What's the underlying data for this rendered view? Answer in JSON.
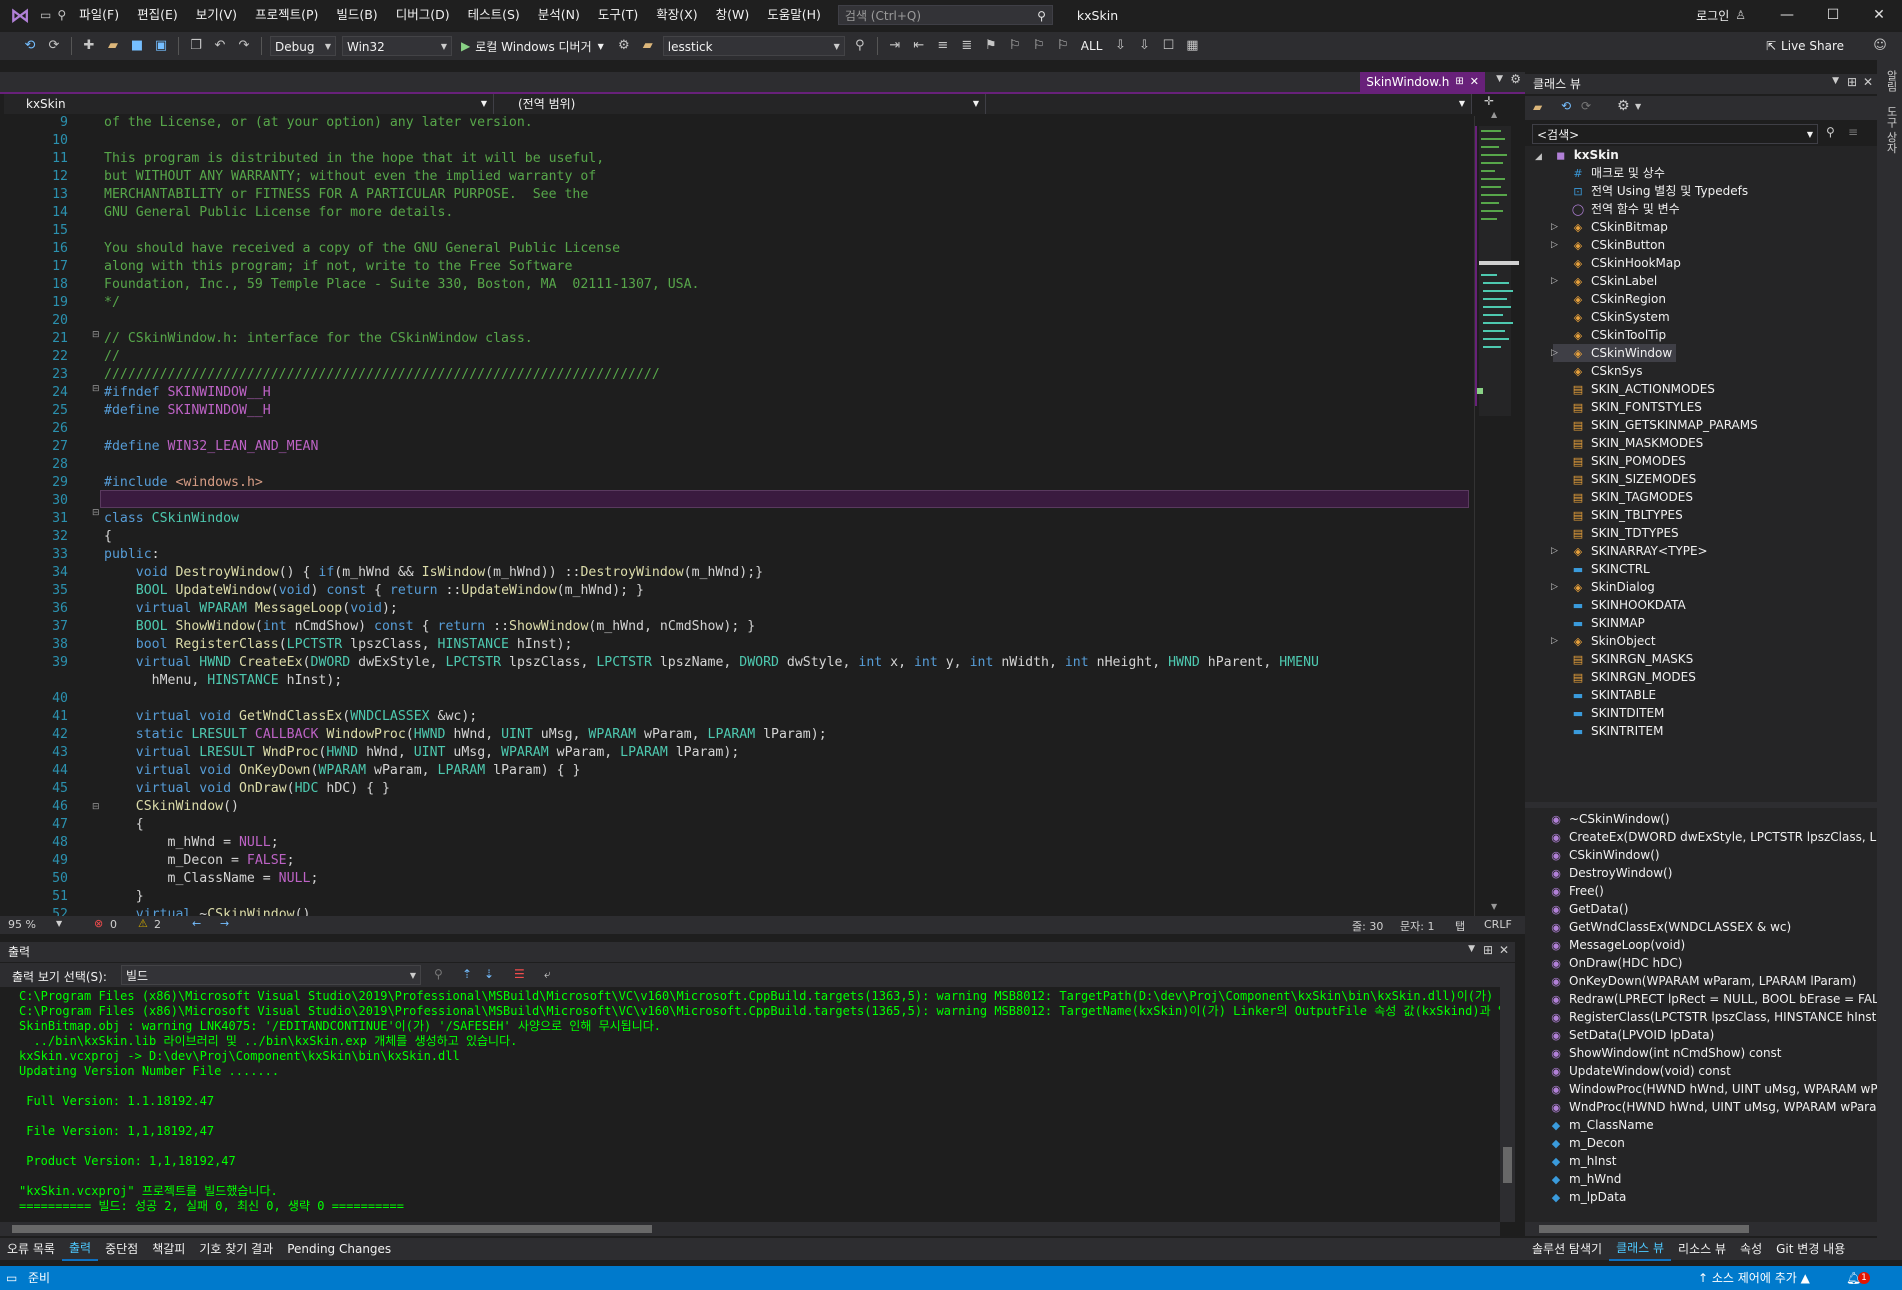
{
  "titlebar": {
    "menus": [
      "파일(F)",
      "편집(E)",
      "보기(V)",
      "프로젝트(P)",
      "빌드(B)",
      "디버그(D)",
      "테스트(S)",
      "분석(N)",
      "도구(T)",
      "확장(X)",
      "창(W)",
      "도움말(H)"
    ],
    "search_placeholder": "검색 (Ctrl+Q)",
    "solution_name": "kxSkin",
    "login": "로그인"
  },
  "toolbar": {
    "config": "Debug",
    "platform": "Win32",
    "run_label": "로컬 Windows 디버거",
    "find_combo": "lesstick",
    "all_label": "ALL",
    "live_share": "Live Share"
  },
  "editor": {
    "tab_title": "SkinWindow.h",
    "nav_project": "kxSkin",
    "nav_scope": "(전역 범위)",
    "zoom": "95 %",
    "errors": "0",
    "warnings": "2",
    "line": "줄: 30",
    "col": "문자: 1",
    "tab_mode": "탭",
    "eol": "CRLF",
    "lines": [
      {
        "n": "9",
        "html": "<span class=\"cm\">of the License, or (at your option) any later version.</span>"
      },
      {
        "n": "10",
        "html": ""
      },
      {
        "n": "11",
        "html": "<span class=\"cm\">This program is distributed in the hope that it will be useful,</span>"
      },
      {
        "n": "12",
        "html": "<span class=\"cm\">but WITHOUT ANY WARRANTY; without even the implied warranty of</span>"
      },
      {
        "n": "13",
        "html": "<span class=\"cm\">MERCHANTABILITY or FITNESS FOR A PARTICULAR PURPOSE.  See the</span>"
      },
      {
        "n": "14",
        "html": "<span class=\"cm\">GNU General Public License for more details.</span>"
      },
      {
        "n": "15",
        "html": ""
      },
      {
        "n": "16",
        "html": "<span class=\"cm\">You should have received a copy of the GNU General Public License</span>"
      },
      {
        "n": "17",
        "html": "<span class=\"cm\">along with this program; if not, write to the Free Software</span>"
      },
      {
        "n": "18",
        "html": "<span class=\"cm\">Foundation, Inc., 59 Temple Place - Suite 330, Boston, MA  02111-1307, USA.</span>"
      },
      {
        "n": "19",
        "html": "<span class=\"cm\">*/</span>"
      },
      {
        "n": "20",
        "html": ""
      },
      {
        "n": "21",
        "html": "<span class=\"cm\">// CSkinWindow.h: interface for the CSkinWindow class.</span>"
      },
      {
        "n": "22",
        "html": "<span class=\"cm\">//</span>"
      },
      {
        "n": "23",
        "html": "<span class=\"cm\">//////////////////////////////////////////////////////////////////////</span>"
      },
      {
        "n": "24",
        "html": "<span class=\"kw\">#ifndef</span> <span class=\"mac\">SKINWINDOW__H</span>"
      },
      {
        "n": "25",
        "html": "<span class=\"kw\">#define</span> <span class=\"mac\">SKINWINDOW__H</span>"
      },
      {
        "n": "26",
        "html": ""
      },
      {
        "n": "27",
        "html": "<span class=\"kw\">#define</span> <span class=\"mac\">WIN32_LEAN_AND_MEAN</span>"
      },
      {
        "n": "28",
        "html": ""
      },
      {
        "n": "29",
        "html": "<span class=\"kw\">#include</span> <span class=\"st\">&lt;windows.h&gt;</span>"
      },
      {
        "n": "30",
        "html": ""
      },
      {
        "n": "31",
        "html": "<span class=\"kw\">class</span> <span class=\"ty\">CSkinWindow</span>"
      },
      {
        "n": "32",
        "html": "{"
      },
      {
        "n": "33",
        "html": "<span class=\"kw\">public</span>:"
      },
      {
        "n": "34",
        "html": "    <span class=\"kw\">void</span> <span class=\"fn\">DestroyWindow</span>() { <span class=\"kw\">if</span>(m_hWnd &amp;&amp; <span class=\"fn\">IsWindow</span>(m_hWnd)) ::<span class=\"fn\">DestroyWindow</span>(m_hWnd);}"
      },
      {
        "n": "35",
        "html": "    <span class=\"ty\">BOOL</span> <span class=\"fn\">UpdateWindow</span>(<span class=\"kw\">void</span>) <span class=\"kw\">const</span> { <span class=\"kw\">return</span> ::<span class=\"fn\">UpdateWindow</span>(m_hWnd); }"
      },
      {
        "n": "36",
        "html": "    <span class=\"kw\">virtual</span> <span class=\"ty\">WPARAM</span> <span class=\"fn\">MessageLoop</span>(<span class=\"kw\">void</span>);"
      },
      {
        "n": "37",
        "html": "    <span class=\"ty\">BOOL</span> <span class=\"fn\">ShowWindow</span>(<span class=\"kw\">int</span> nCmdShow) <span class=\"kw\">const</span> { <span class=\"kw\">return</span> ::<span class=\"fn\">ShowWindow</span>(m_hWnd, nCmdShow); }"
      },
      {
        "n": "38",
        "html": "    <span class=\"kw\">bool</span> <span class=\"fn\">RegisterClass</span>(<span class=\"ty\">LPCTSTR</span> lpszClass, <span class=\"ty\">HINSTANCE</span> hInst);"
      },
      {
        "n": "39",
        "html": "    <span class=\"kw\">virtual</span> <span class=\"ty\">HWND</span> <span class=\"fn\">CreateEx</span>(<span class=\"ty\">DWORD</span> dwExStyle, <span class=\"ty\">LPCTSTR</span> lpszClass, <span class=\"ty\">LPCTSTR</span> lpszName, <span class=\"ty\">DWORD</span> dwStyle, <span class=\"kw\">int</span> x, <span class=\"kw\">int</span> y, <span class=\"kw\">int</span> nWidth, <span class=\"kw\">int</span> nHeight, <span class=\"ty\">HWND</span> hParent, <span class=\"ty\">HMENU</span>"
      },
      {
        "n": "",
        "html": "      hMenu, <span class=\"ty\">HINSTANCE</span> hInst);"
      },
      {
        "n": "40",
        "html": ""
      },
      {
        "n": "41",
        "html": "    <span class=\"kw\">virtual</span> <span class=\"kw\">void</span> <span class=\"fn\">GetWndClassEx</span>(<span class=\"ty\">WNDCLASSEX</span> &amp;wc);"
      },
      {
        "n": "42",
        "html": "    <span class=\"kw\">static</span> <span class=\"ty\">LRESULT</span> <span class=\"mac\">CALLBACK</span> <span class=\"fn\">WindowProc</span>(<span class=\"ty\">HWND</span> hWnd, <span class=\"ty\">UINT</span> uMsg, <span class=\"ty\">WPARAM</span> wParam, <span class=\"ty\">LPARAM</span> lParam);"
      },
      {
        "n": "43",
        "html": "    <span class=\"kw\">virtual</span> <span class=\"ty\">LRESULT</span> <span class=\"fn\">WndProc</span>(<span class=\"ty\">HWND</span> hWnd, <span class=\"ty\">UINT</span> uMsg, <span class=\"ty\">WPARAM</span> wParam, <span class=\"ty\">LPARAM</span> lParam);"
      },
      {
        "n": "44",
        "html": "    <span class=\"kw\">virtual</span> <span class=\"kw\">void</span> <span class=\"fn\">OnKeyDown</span>(<span class=\"ty\">WPARAM</span> wParam, <span class=\"ty\">LPARAM</span> lParam) { }"
      },
      {
        "n": "45",
        "html": "    <span class=\"kw\">virtual</span> <span class=\"kw\">void</span> <span class=\"fn\">OnDraw</span>(<span class=\"ty\">HDC</span> hDC) { }"
      },
      {
        "n": "46",
        "html": "    <span class=\"fn\">CSkinWindow</span>()"
      },
      {
        "n": "47",
        "html": "    {"
      },
      {
        "n": "48",
        "html": "        m_hWnd = <span class=\"mac\">NULL</span>;"
      },
      {
        "n": "49",
        "html": "        m_Decon = <span class=\"mac\">FALSE</span>;"
      },
      {
        "n": "50",
        "html": "        m_ClassName = <span class=\"mac\">NULL</span>;"
      },
      {
        "n": "51",
        "html": "    }"
      },
      {
        "n": "52",
        "html": "    <span class=\"kw\">virtual</span> ~<span class=\"fn\">CSkinWindow</span>()"
      }
    ]
  },
  "output": {
    "title": "출력",
    "show_label": "출력 보기 선택(S):",
    "source": "빌드",
    "lines": [
      "C:\\Program Files (x86)\\Microsoft Visual Studio\\2019\\Professional\\MSBuild\\Microsoft\\VC\\v160\\Microsoft.CppBuild.targets(1363,5): warning MSB8012: TargetPath(D:\\dev\\Proj\\Component\\kxSkin\\bin\\kxSkin.dll)이(가) Linker",
      "C:\\Program Files (x86)\\Microsoft Visual Studio\\2019\\Professional\\MSBuild\\Microsoft\\VC\\v160\\Microsoft.CppBuild.targets(1365,5): warning MSB8012: TargetName(kxSkin)이(가) Linker의 OutputFile 속성 값(kxSkind)과 일치",
      "SkinBitmap.obj : warning LNK4075: '/EDITANDCONTINUE'이(가) '/SAFESEH' 사양으로 인해 무시됩니다.",
      "  ../bin\\kxSkin.lib 라이브러리 및 ../bin\\kxSkin.exp 개체를 생성하고 있습니다.",
      "kxSkin.vcxproj -> D:\\dev\\Proj\\Component\\kxSkin\\bin\\kxSkin.dll",
      "Updating Version Number File .......",
      "",
      " Full Version: 1.1.18192.47",
      "",
      " File Version: 1,1,18192,47",
      "",
      " Product Version: 1,1,18192,47",
      "",
      "\"kxSkin.vcxproj\" 프로젝트를 빌드했습니다.",
      "========== 빌드: 성공 2, 실패 0, 최신 0, 생략 0 =========="
    ]
  },
  "bottom_tabs": [
    "오류 목록",
    "출력",
    "중단점",
    "책갈피",
    "기호 찾기 결과",
    "Pending Changes"
  ],
  "classview": {
    "title": "클래스 뷰",
    "search": "<검색>",
    "root": "kxSkin",
    "items": [
      {
        "label": "매크로 및 상수",
        "icon": "macro-icon",
        "exp": false
      },
      {
        "label": "전역 Using 별칭 및 Typedefs",
        "icon": "typedef-icon",
        "exp": false
      },
      {
        "label": "전역 함수 및 변수",
        "icon": "global-icon",
        "exp": false
      },
      {
        "label": "CSkinBitmap",
        "icon": "class-icon",
        "exp": true
      },
      {
        "label": "CSkinButton",
        "icon": "class-icon",
        "exp": true
      },
      {
        "label": "CSkinHookMap",
        "icon": "class-icon",
        "exp": false
      },
      {
        "label": "CSkinLabel",
        "icon": "class-icon",
        "exp": true
      },
      {
        "label": "CSkinRegion",
        "icon": "class-icon",
        "exp": false
      },
      {
        "label": "CSkinSystem",
        "icon": "class-icon",
        "exp": false
      },
      {
        "label": "CSkinToolTip",
        "icon": "class-icon",
        "exp": false
      },
      {
        "label": "CSkinWindow",
        "icon": "class-icon",
        "exp": true,
        "selected": true
      },
      {
        "label": "CSknSys",
        "icon": "class-icon",
        "exp": false
      },
      {
        "label": "SKIN_ACTIONMODES",
        "icon": "enum-icon",
        "exp": false
      },
      {
        "label": "SKIN_FONTSTYLES",
        "icon": "enum-icon",
        "exp": false
      },
      {
        "label": "SKIN_GETSKINMAP_PARAMS",
        "icon": "enum-icon",
        "exp": false
      },
      {
        "label": "SKIN_MASKMODES",
        "icon": "enum-icon",
        "exp": false
      },
      {
        "label": "SKIN_POMODES",
        "icon": "enum-icon",
        "exp": false
      },
      {
        "label": "SKIN_SIZEMODES",
        "icon": "enum-icon",
        "exp": false
      },
      {
        "label": "SKIN_TAGMODES",
        "icon": "enum-icon",
        "exp": false
      },
      {
        "label": "SKIN_TBLTYPES",
        "icon": "enum-icon",
        "exp": false
      },
      {
        "label": "SKIN_TDTYPES",
        "icon": "enum-icon",
        "exp": false
      },
      {
        "label": "SKINARRAY<TYPE>",
        "icon": "class-icon",
        "exp": true
      },
      {
        "label": "SKINCTRL",
        "icon": "struct-icon",
        "exp": false
      },
      {
        "label": "SkinDialog",
        "icon": "class-icon",
        "exp": true
      },
      {
        "label": "SKINHOOKDATA",
        "icon": "struct-icon",
        "exp": false
      },
      {
        "label": "SKINMAP",
        "icon": "struct-icon",
        "exp": false
      },
      {
        "label": "SkinObject",
        "icon": "class-icon",
        "exp": true
      },
      {
        "label": "SKINRGN_MASKS",
        "icon": "enum-icon",
        "exp": false
      },
      {
        "label": "SKINRGN_MODES",
        "icon": "enum-icon",
        "exp": false
      },
      {
        "label": "SKINTABLE",
        "icon": "struct-icon",
        "exp": false
      },
      {
        "label": "SKINTDITEM",
        "icon": "struct-icon",
        "exp": false
      },
      {
        "label": "SKINTRITEM",
        "icon": "struct-icon",
        "exp": false
      }
    ],
    "members": [
      {
        "label": "~CSkinWindow()",
        "icon": "method-icon"
      },
      {
        "label": "CreateEx(DWORD dwExStyle, LPCTSTR lpszClass, LPCTS",
        "icon": "method-icon"
      },
      {
        "label": "CSkinWindow()",
        "icon": "method-icon"
      },
      {
        "label": "DestroyWindow()",
        "icon": "method-icon"
      },
      {
        "label": "Free()",
        "icon": "method-icon"
      },
      {
        "label": "GetData()",
        "icon": "method-icon"
      },
      {
        "label": "GetWndClassEx(WNDCLASSEX & wc)",
        "icon": "method-icon"
      },
      {
        "label": "MessageLoop(void)",
        "icon": "method-icon"
      },
      {
        "label": "OnDraw(HDC hDC)",
        "icon": "method-icon"
      },
      {
        "label": "OnKeyDown(WPARAM wParam, LPARAM lParam)",
        "icon": "method-icon"
      },
      {
        "label": "Redraw(LPRECT lpRect = NULL, BOOL bErase = FALSE)",
        "icon": "method-icon"
      },
      {
        "label": "RegisterClass(LPCTSTR lpszClass, HINSTANCE hInst)",
        "icon": "method-icon"
      },
      {
        "label": "SetData(LPVOID lpData)",
        "icon": "method-icon"
      },
      {
        "label": "ShowWindow(int nCmdShow) const",
        "icon": "method-icon"
      },
      {
        "label": "UpdateWindow(void) const",
        "icon": "method-icon"
      },
      {
        "label": "WindowProc(HWND hWnd, UINT uMsg, WPARAM wPa",
        "icon": "method-icon"
      },
      {
        "label": "WndProc(HWND hWnd, UINT uMsg, WPARAM wParam",
        "icon": "method-icon"
      },
      {
        "label": "m_ClassName",
        "icon": "field-icon"
      },
      {
        "label": "m_Decon",
        "icon": "field-icon"
      },
      {
        "label": "m_hInst",
        "icon": "field-icon"
      },
      {
        "label": "m_hWnd",
        "icon": "field-icon"
      },
      {
        "label": "m_lpData",
        "icon": "field-icon"
      }
    ],
    "bottom_tabs": [
      "솔루션 탐색기",
      "클래스 뷰",
      "리소스 뷰",
      "속성",
      "Git 변경 내용"
    ]
  },
  "side_strip": [
    "알림",
    "도구 상자"
  ],
  "statusbar": {
    "ready": "준비",
    "source_control": "소스 제어에 추가",
    "notifications": "1"
  },
  "colors": {
    "accent": "#68217a",
    "statusbar": "#007acc",
    "output_text": "#00ff00"
  }
}
